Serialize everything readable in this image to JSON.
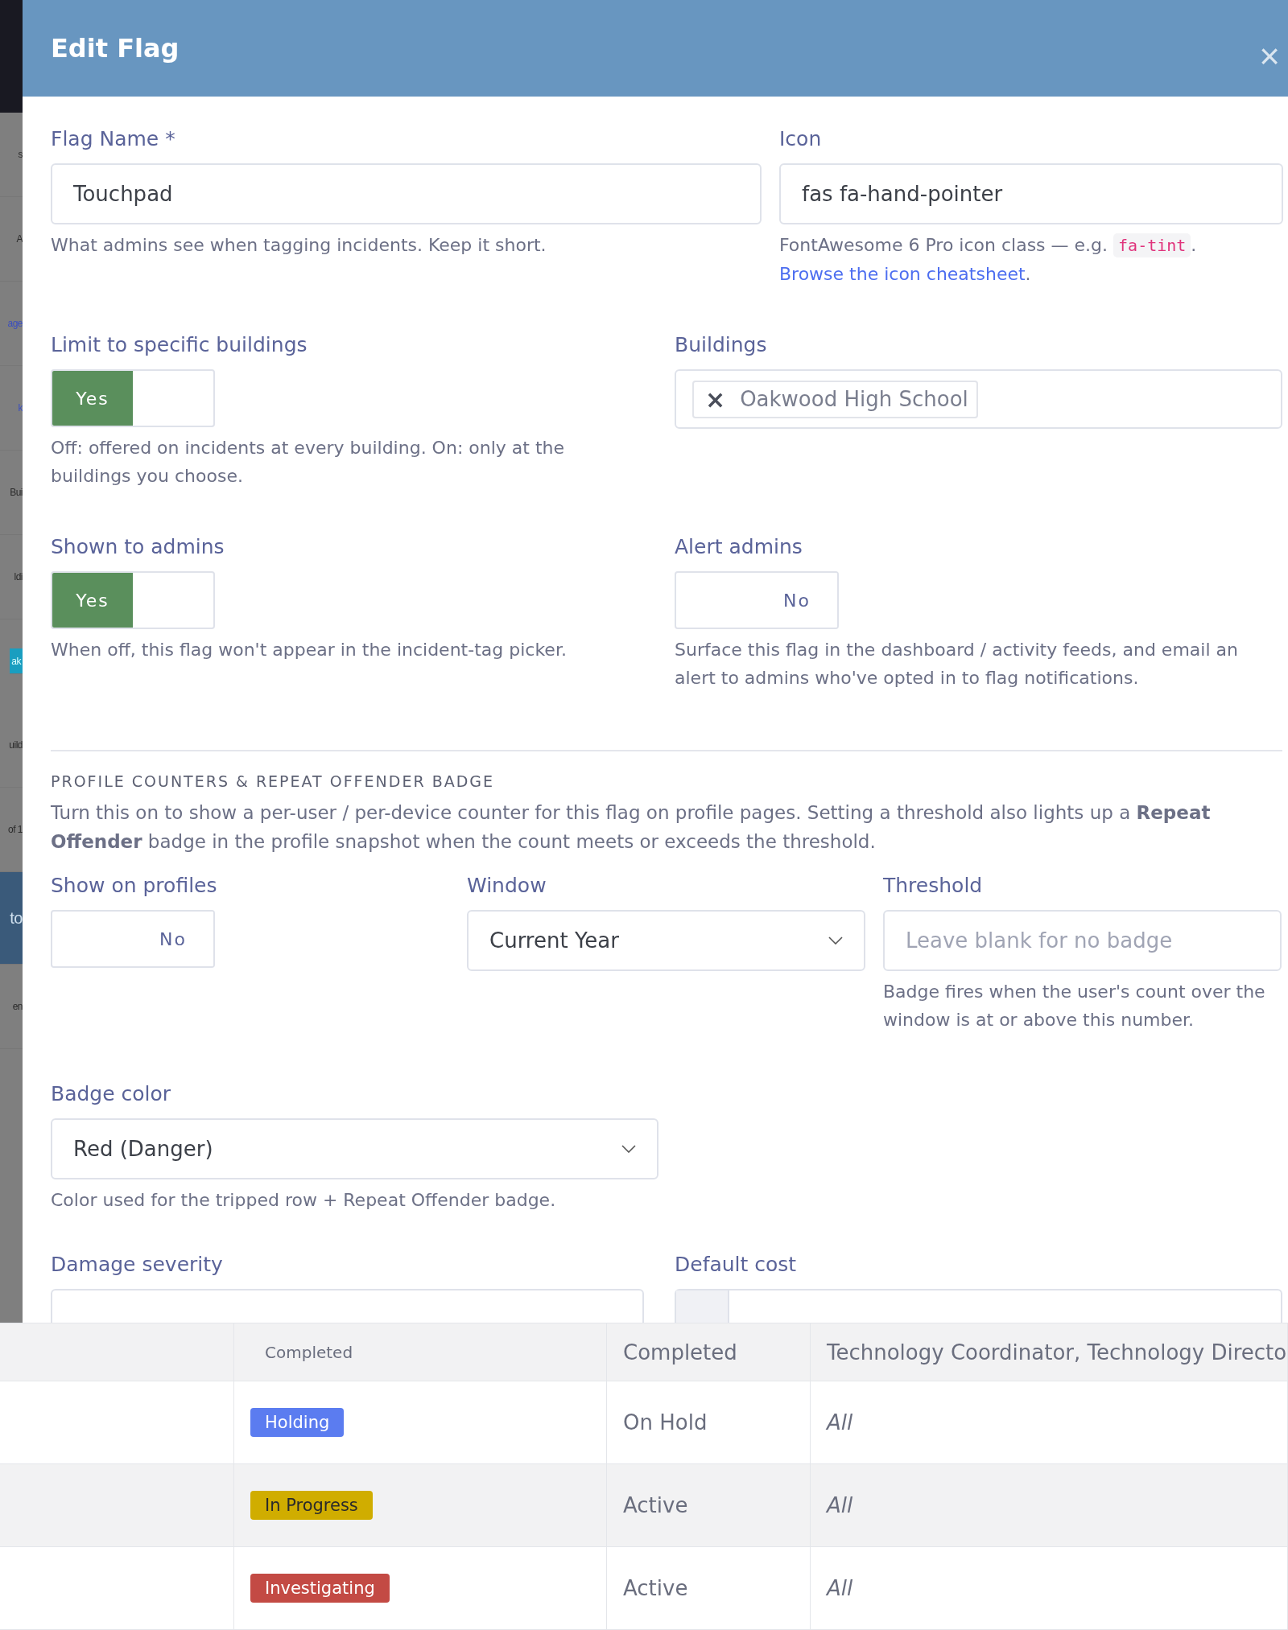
{
  "background_fragments": [
    {
      "text": "s",
      "kind": "plain"
    },
    {
      "text": "A",
      "kind": "plain"
    },
    {
      "text": "age",
      "kind": "link"
    },
    {
      "text": "k",
      "kind": "link"
    },
    {
      "text": "Bui",
      "kind": "plain"
    },
    {
      "text": "ldi",
      "kind": "plain"
    },
    {
      "text": "ak",
      "kind": "tag"
    },
    {
      "text": "uild",
      "kind": "plain"
    },
    {
      "text": "of 1",
      "kind": "plain"
    },
    {
      "text": "to",
      "kind": "banner"
    },
    {
      "text": "en",
      "kind": "plain"
    }
  ],
  "modal": {
    "title": "Edit Flag",
    "close": "×",
    "flag_name": {
      "label": "Flag Name *",
      "value": "Touchpad",
      "help": "What admins see when tagging incidents. Keep it short."
    },
    "icon": {
      "label": "Icon",
      "value": "fas fa-hand-pointer",
      "help_text": "FontAwesome 6 Pro icon class — e.g.",
      "help_code": "fa-tint",
      "help_end": ".",
      "link": "Browse the icon cheatsheet",
      "link_end": "."
    },
    "limit_buildings": {
      "label": "Limit to specific buildings",
      "on": true,
      "text": "Yes",
      "help": "Off: offered on incidents at every building. On: only at the buildings you choose."
    },
    "buildings": {
      "label": "Buildings",
      "chips": [
        {
          "remove": "×",
          "text": "Oakwood High School"
        }
      ]
    },
    "shown_to_admins": {
      "label": "Shown to admins",
      "on": true,
      "text": "Yes",
      "help": "When off, this flag won't appear in the incident-tag picker."
    },
    "alert_admins": {
      "label": "Alert admins",
      "on": false,
      "text": "No",
      "help": "Surface this flag in the dashboard / activity feeds, and email an alert to admins who've opted in to flag notifications."
    },
    "profile_section": {
      "heading": "PROFILE COUNTERS & REPEAT OFFENDER BADGE",
      "text": "Turn this on to show a per-user / per-device counter for this flag on profile pages. Setting a threshold also lights up a **Repeat Offender** badge in the profile snapshot when the count meets or exceeds the threshold."
    },
    "show_on_profiles": {
      "label": "Show on profiles",
      "on": false,
      "text": "No"
    },
    "window": {
      "label": "Window",
      "value": "Current Year"
    },
    "threshold": {
      "label": "Threshold",
      "placeholder": "Leave blank for no badge",
      "help": "Badge fires when the user's count over the window is at or above this number."
    },
    "badge_color": {
      "label": "Badge color",
      "value": "Red (Danger)",
      "help": "Color used for the tripped row + Repeat Offender badge."
    },
    "damage_severity": {
      "label": "Damage severity"
    },
    "default_cost": {
      "label": "Default cost"
    }
  },
  "table": {
    "header_row": {
      "column_2": "Completed",
      "column_3": "Completed",
      "column_4": "Technology Coordinator, Technology Directo"
    },
    "rows": [
      {
        "badge": "Holding",
        "color": "#5b7cf0",
        "status": "On Hold",
        "scope": "All"
      },
      {
        "badge": "In Progress",
        "color": "#d0ad00",
        "status": "Active",
        "scope": "All"
      },
      {
        "badge": "Investigating",
        "color": "#c34a44",
        "status": "Active",
        "scope": "All"
      }
    ]
  }
}
